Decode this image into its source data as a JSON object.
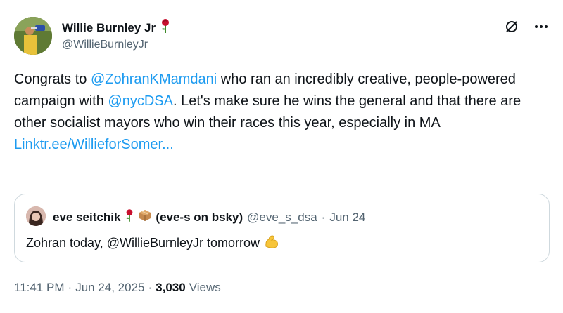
{
  "author": {
    "name": "Willie Burnley Jr",
    "handle": "@WillieBurnleyJr",
    "name_emoji": "rose-icon"
  },
  "tweet": {
    "text_1": "Congrats to ",
    "mention_1": "@ZohranKMamdani",
    "text_2": " who ran an incredibly creative, people-powered campaign with ",
    "mention_2": "@nycDSA",
    "text_3": ". Let's make sure he wins the general and that there are other socialist mayors who win their races this year, especially in MA",
    "link": "Linktr.ee/WillieforSomer..."
  },
  "quote": {
    "author_name": "eve seitchik",
    "name_suffix": "(eve-s on bsky)",
    "handle": "@eve_s_dsa",
    "separator": "·",
    "date": "Jun 24",
    "text": "Zohran today, @WillieBurnleyJr tomorrow",
    "emoji": "flexed-bicep-icon"
  },
  "footer": {
    "time": "11:41 PM",
    "sep1": "·",
    "date": "Jun 24, 2025",
    "sep2": "·",
    "views_count": "3,030",
    "views_label": "Views"
  },
  "colors": {
    "link": "#1d9bf0",
    "secondary_text": "#536471",
    "border": "#cfd9de"
  }
}
